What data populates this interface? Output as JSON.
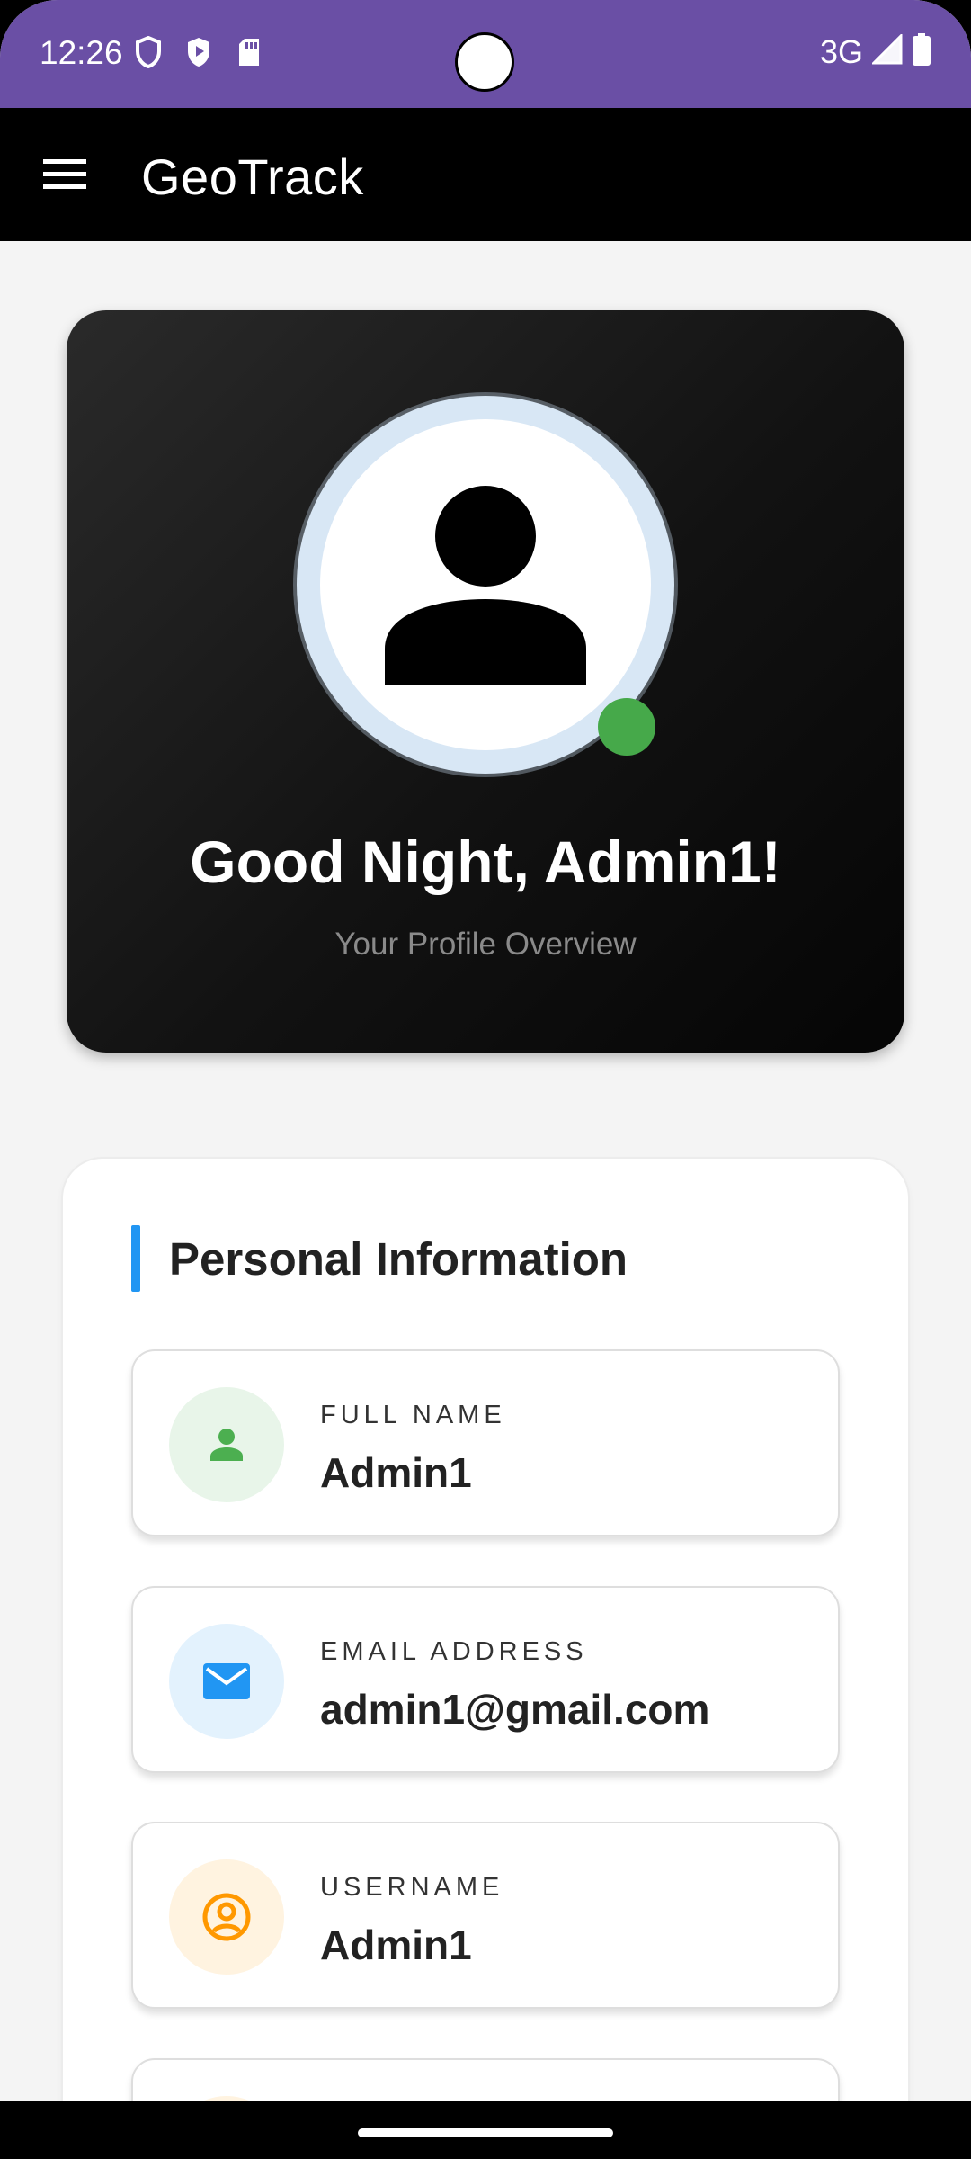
{
  "status_bar": {
    "time": "12:26",
    "network": "3G",
    "icons": [
      "shield-outline-icon",
      "shield-play-icon",
      "sd-card-icon",
      "signal-icon",
      "battery-icon"
    ]
  },
  "app_bar": {
    "title": "GeoTrack",
    "menu_icon": "menu-icon"
  },
  "profile": {
    "greeting": "Good Night, Admin1!",
    "subtitle": "Your Profile Overview",
    "online_status_color": "#46a94a"
  },
  "personal_info": {
    "title": "Personal Information",
    "accent_color": "#2196f3",
    "items": [
      {
        "label": "FULL NAME",
        "value": "Admin1",
        "icon": "person-icon",
        "icon_color": "#4caf50",
        "bg": "#e8f5e9"
      },
      {
        "label": "EMAIL ADDRESS",
        "value": "admin1@gmail.com",
        "icon": "email-icon",
        "icon_color": "#2196f3",
        "bg": "#e3f2fd"
      },
      {
        "label": "USERNAME",
        "value": "Admin1",
        "icon": "account-circle-icon",
        "icon_color": "#ff9800",
        "bg": "#fff3e0"
      }
    ]
  }
}
